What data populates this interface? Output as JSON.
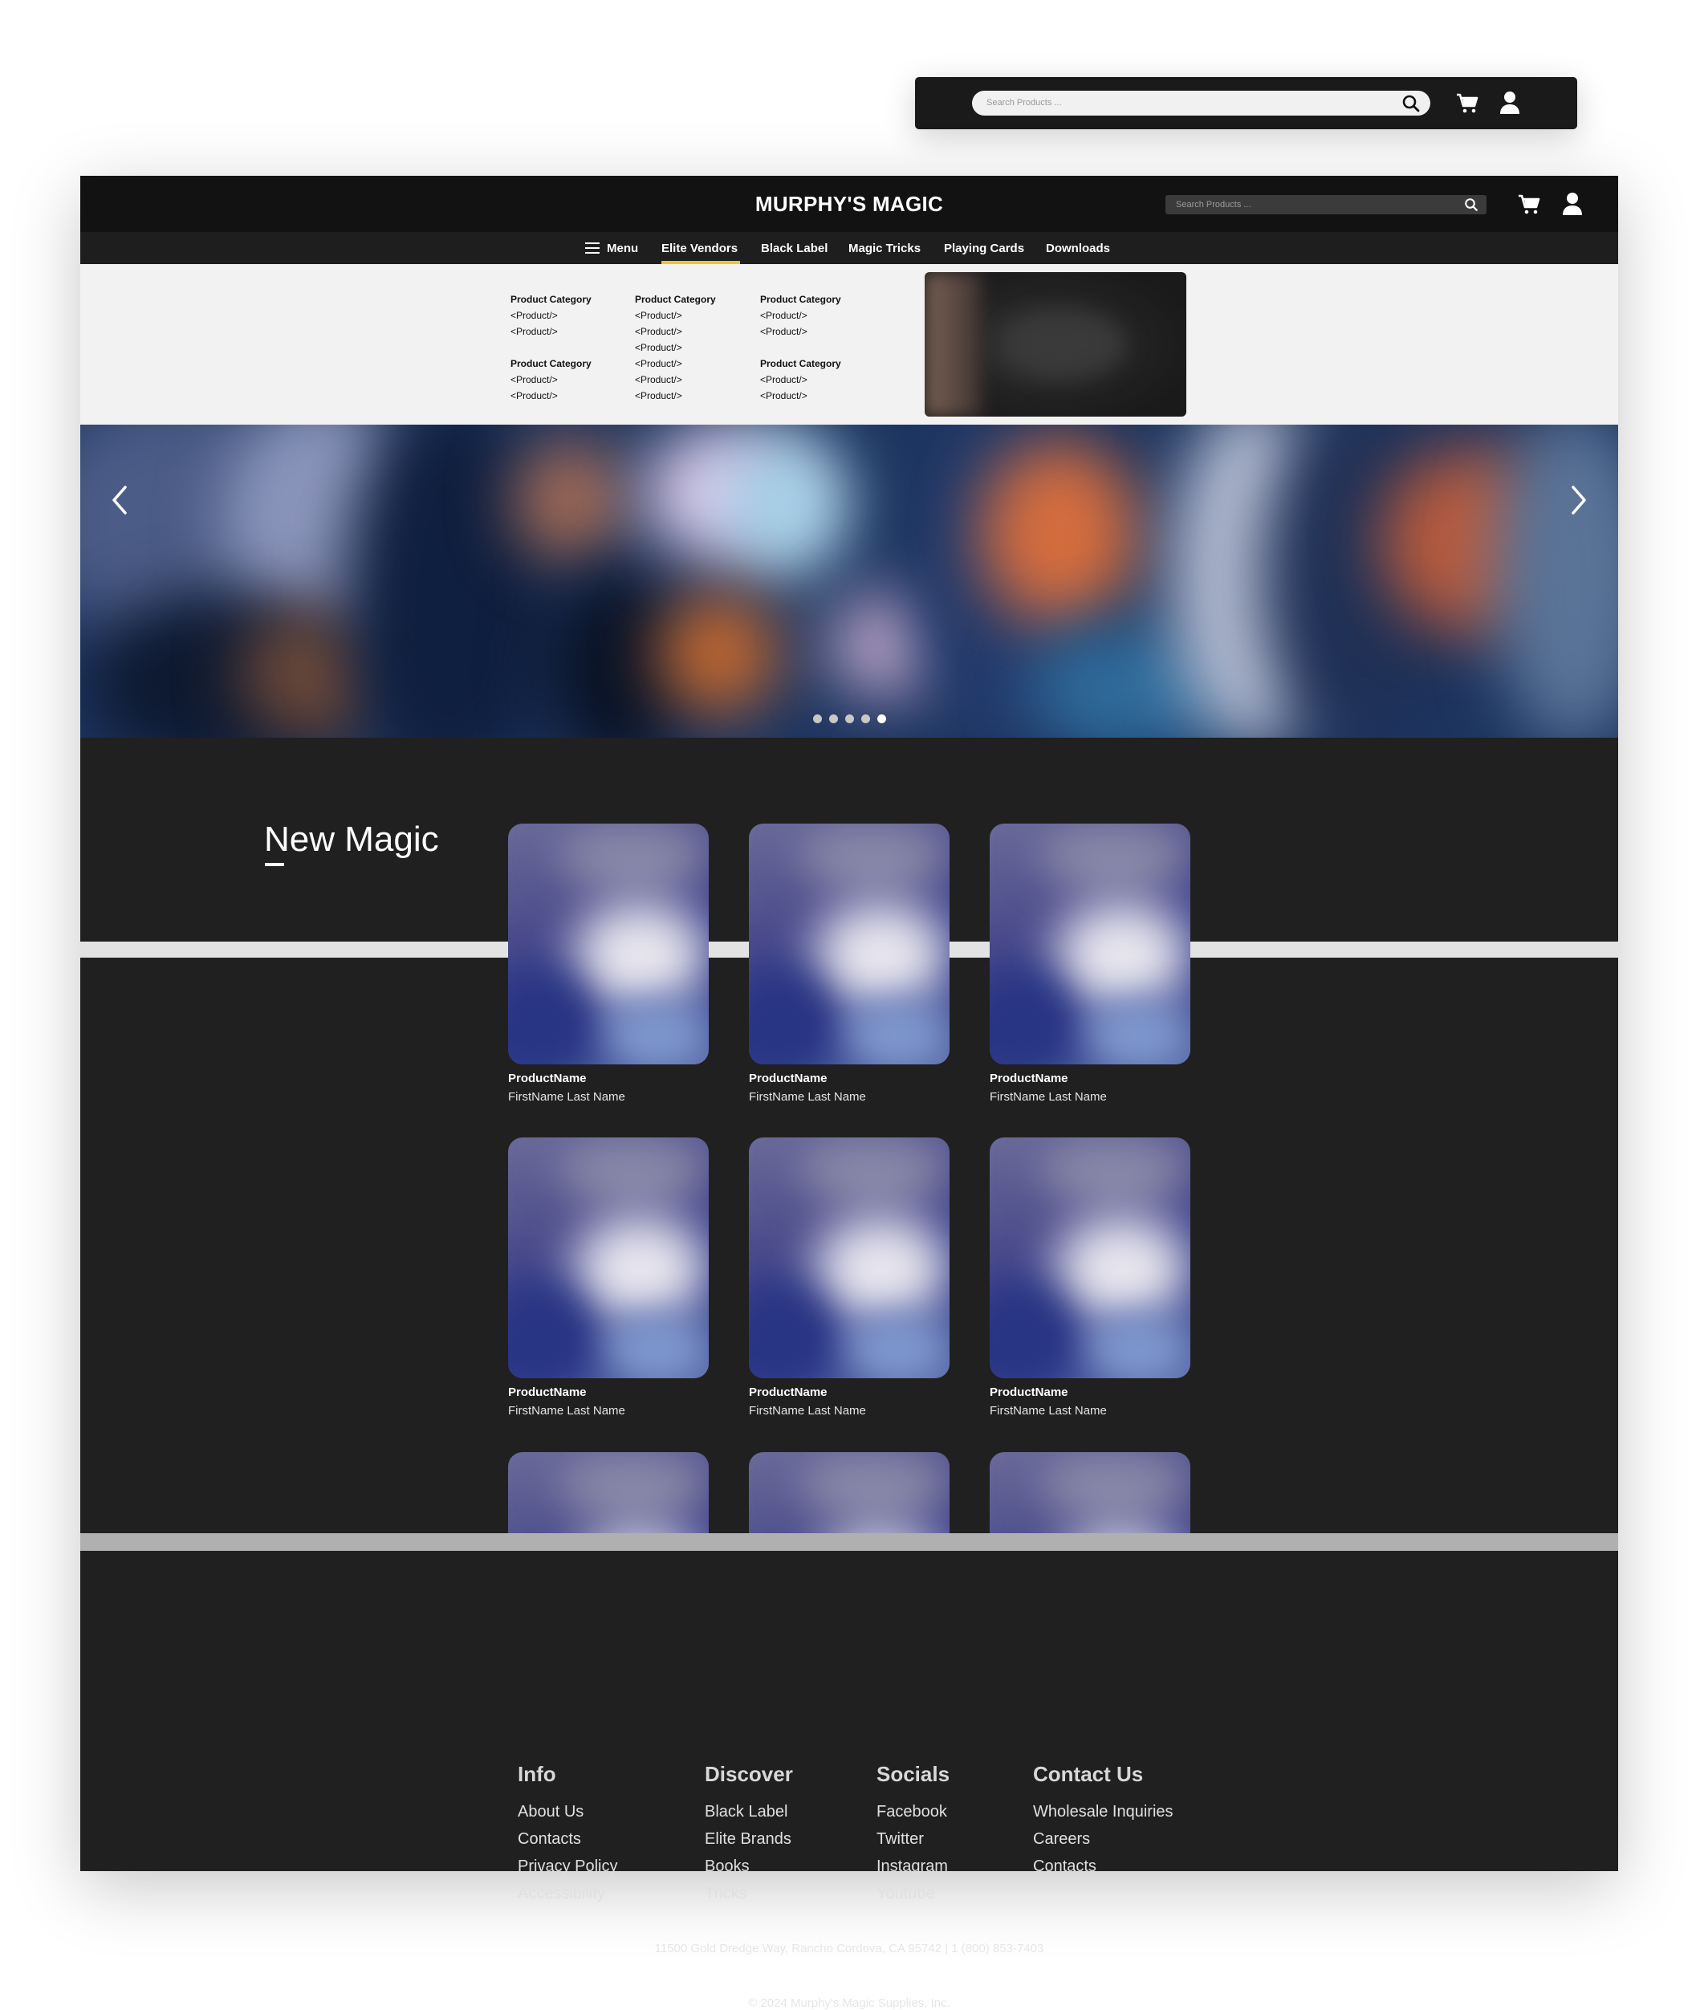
{
  "compact_header": {
    "search_placeholder": "Search Products ...",
    "icons": [
      "search-icon",
      "cart-icon",
      "user-icon"
    ]
  },
  "header": {
    "brand": "MURPHY'S MAGIC",
    "search_placeholder": "Search Products ...",
    "icons": [
      "search-icon",
      "cart-icon",
      "user-icon"
    ]
  },
  "nav": {
    "menu_label": "Menu",
    "items": [
      "Elite Vendors",
      "Black Label",
      "Magic Tricks",
      "Playing Cards",
      "Downloads"
    ],
    "active": "Elite Vendors",
    "accent_color": "#f2c233"
  },
  "mega_menu": {
    "columns": [
      {
        "groups": [
          {
            "category": "Product Category",
            "products": [
              "<Product/>",
              "<Product/>"
            ]
          },
          {
            "category": "Product Category",
            "products": [
              "<Product/>",
              "<Product/>"
            ]
          }
        ]
      },
      {
        "groups": [
          {
            "category": "Product Category",
            "products": [
              "<Product/>",
              "<Product/>",
              "<Product/>",
              "<Product/>",
              "<Product/>",
              "<Product/>"
            ]
          }
        ]
      },
      {
        "groups": [
          {
            "category": "Product Category",
            "products": [
              "<Product/>",
              "<Product/>"
            ]
          },
          {
            "category": "Product Category",
            "products": [
              "<Product/>",
              "<Product/>"
            ]
          }
        ]
      }
    ]
  },
  "hero": {
    "prev_icon": "chevron-left-icon",
    "next_icon": "chevron-right-icon",
    "slide_count": 5,
    "active_slide": 5
  },
  "new_magic": {
    "title": "New Magic",
    "products": [
      {
        "name": "ProductName",
        "author": "FirstName Last Name"
      },
      {
        "name": "ProductName",
        "author": "FirstName Last Name"
      },
      {
        "name": "ProductName",
        "author": "FirstName Last Name"
      },
      {
        "name": "ProductName",
        "author": "FirstName Last Name"
      },
      {
        "name": "ProductName",
        "author": "FirstName Last Name"
      },
      {
        "name": "ProductName",
        "author": "FirstName Last Name"
      }
    ]
  },
  "footer": {
    "columns": [
      {
        "heading": "Info",
        "links": [
          "About Us",
          "Contacts",
          "Privacy Policy",
          "Accessibility"
        ]
      },
      {
        "heading": "Discover",
        "links": [
          "Black Label",
          "Elite Brands",
          "Books",
          "Tricks"
        ]
      },
      {
        "heading": "Socials",
        "links": [
          "Facebook",
          "Twitter",
          "Instagram",
          "Youtube"
        ]
      },
      {
        "heading": "Contact Us",
        "links": [
          "Wholesale Inquiries",
          "Careers",
          "Contacts"
        ]
      }
    ],
    "address": "11500 Gold Dredge Way, Rancho Cordova, CA 95742 | 1 (800) 853-7403",
    "copyright": "© 2024 Murphy's Magic Supplies, Inc."
  }
}
